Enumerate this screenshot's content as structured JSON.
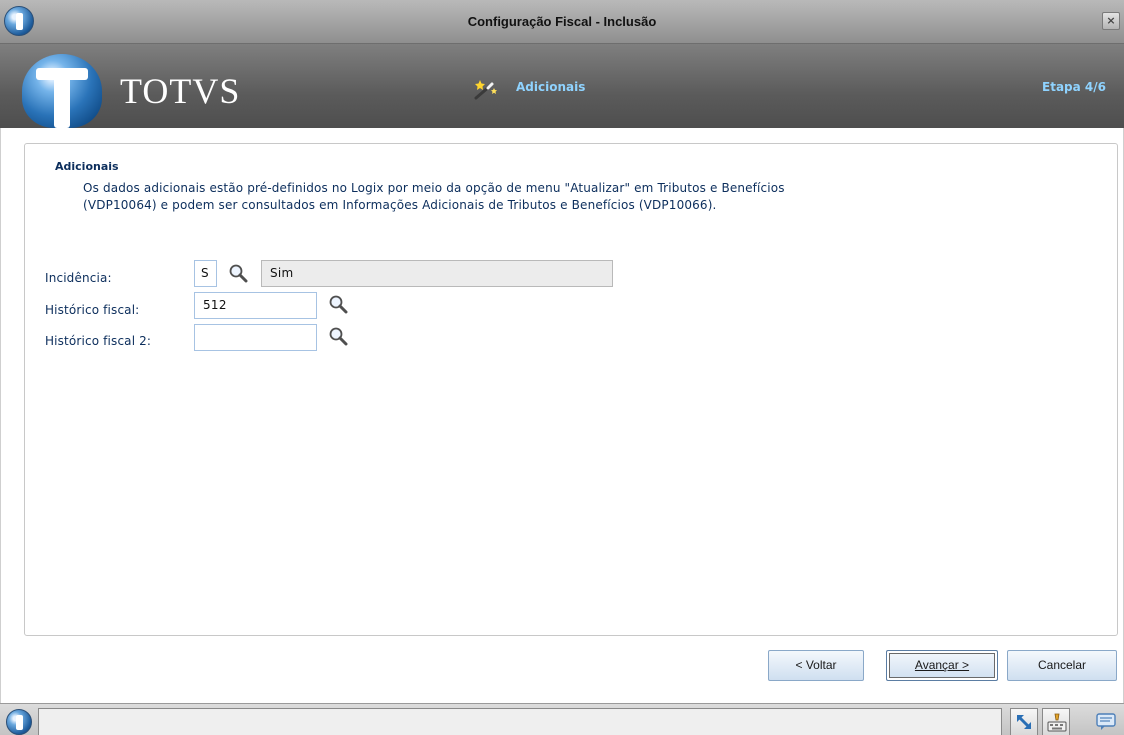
{
  "window": {
    "title": "Configuração Fiscal - Inclusão",
    "close_label": "×"
  },
  "banner": {
    "logo_text": "TOTVS",
    "step_title": "Adicionais",
    "step_counter": "Etapa 4/6"
  },
  "section": {
    "title": "Adicionais",
    "description_line1": "Os dados adicionais estão pré-definidos no Logix por meio da opção de menu \"Atualizar\" em Tributos e Benefícios",
    "description_line2": "(VDP10064) e podem ser consultados em Informações Adicionais de Tributos e Benefícios (VDP10066)."
  },
  "fields": {
    "incidencia": {
      "label": "Incidência:",
      "code": "S",
      "description": "Sim"
    },
    "historico_fiscal": {
      "label": "Histórico fiscal:",
      "value": "512"
    },
    "historico_fiscal_2": {
      "label": "Histórico fiscal 2:",
      "value": ""
    }
  },
  "buttons": {
    "back": "< Voltar",
    "next": "Avançar >",
    "cancel": "Cancelar"
  },
  "icons": {
    "app": "totvs-globe-icon",
    "step": "magic-wand-icon",
    "lookup": "magnifier-icon",
    "tray": [
      "resize-arrow-icon",
      "keyboard-icon",
      "chat-icon"
    ]
  },
  "colors": {
    "label_text": "#0c2e5c",
    "banner_accent": "#8fd3ff",
    "input_border": "#a7c3e3"
  }
}
